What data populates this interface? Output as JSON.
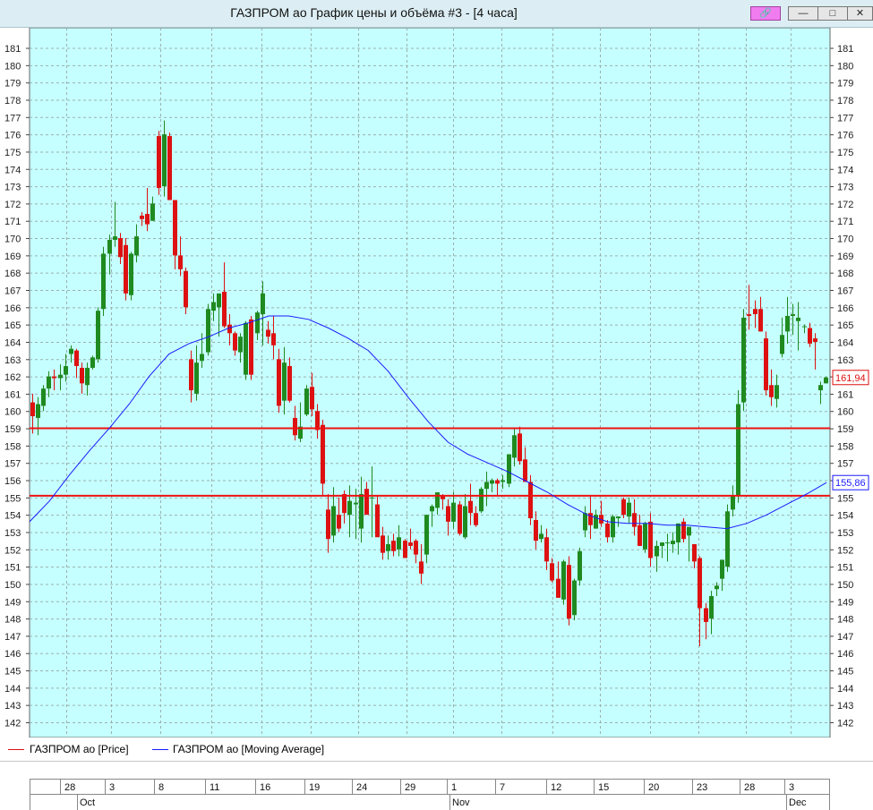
{
  "window": {
    "title": "ГАЗПРОМ ао График цены и объёма #3 - [4 часа]",
    "buttons": [
      "link-icon",
      "minimize-icon",
      "restore-icon",
      "close-icon"
    ]
  },
  "colors": {
    "background": "#c6ffff",
    "grid": "#9ab0b0",
    "up_candle": "#1f8a1f",
    "down_candle": "#dd1111",
    "moving_average": "#1a1aff",
    "level_lines": "#ee1111"
  },
  "legend": {
    "price_label": "ГАЗПРОМ ао [Price]",
    "ma_label": "ГАЗПРОМ ао [Moving Average]"
  },
  "chart_data": {
    "type": "candlestick",
    "y_ticks": [
      142,
      143,
      144,
      145,
      146,
      147,
      148,
      149,
      150,
      151,
      152,
      153,
      154,
      155,
      156,
      157,
      158,
      159,
      160,
      161,
      162,
      163,
      164,
      165,
      166,
      167,
      168,
      169,
      170,
      171,
      172,
      173,
      174,
      175,
      176,
      177,
      178,
      179,
      180,
      181
    ],
    "ylim": [
      141.1,
      182
    ],
    "last_price_label": "161,94",
    "ma_last_label": "155,86",
    "horizontal_levels": [
      159.0,
      155.1
    ],
    "x_day_labels": [
      "28",
      "3",
      "8",
      "11",
      "16",
      "19",
      "24",
      "29",
      "1",
      "7",
      "12",
      "15",
      "20",
      "23",
      "28",
      "3"
    ],
    "x_month_labels": [
      "Oct",
      "Nov",
      "Dec"
    ],
    "candles": [
      [
        160.5,
        161.0,
        158.7,
        159.7
      ],
      [
        159.6,
        160.8,
        158.6,
        160.4
      ],
      [
        160.3,
        161.5,
        160.0,
        161.3
      ],
      [
        161.3,
        162.3,
        160.8,
        162.0
      ],
      [
        162.0,
        162.4,
        161.2,
        161.9
      ],
      [
        161.9,
        162.7,
        161.2,
        162.1
      ],
      [
        162.1,
        163.3,
        161.7,
        162.6
      ],
      [
        163.3,
        163.8,
        162.8,
        163.6
      ],
      [
        163.5,
        163.6,
        161.9,
        162.6
      ],
      [
        162.5,
        162.8,
        161.0,
        161.6
      ],
      [
        161.5,
        162.8,
        160.9,
        162.5
      ],
      [
        162.5,
        163.2,
        162.4,
        163.1
      ],
      [
        163.0,
        166.0,
        162.8,
        165.8
      ],
      [
        165.9,
        169.5,
        165.5,
        169.1
      ],
      [
        169.1,
        170.2,
        167.9,
        169.9
      ],
      [
        169.9,
        172.1,
        169.5,
        170.1
      ],
      [
        170.0,
        170.3,
        168.5,
        168.9
      ],
      [
        169.6,
        170.0,
        166.4,
        166.8
      ],
      [
        166.7,
        169.2,
        166.4,
        169.1
      ],
      [
        169.0,
        170.8,
        168.6,
        170.1
      ],
      [
        171.3,
        171.5,
        170.7,
        171.1
      ],
      [
        171.4,
        172.9,
        170.4,
        170.8
      ],
      [
        171.0,
        172.4,
        171.0,
        172.0
      ],
      [
        175.9,
        176.2,
        172.5,
        172.9
      ],
      [
        173.0,
        176.8,
        172.4,
        176.0
      ],
      [
        175.9,
        176.1,
        172.4,
        172.2
      ],
      [
        172.2,
        172.2,
        168.2,
        169.0
      ],
      [
        169.0,
        170.1,
        167.8,
        168.2
      ],
      [
        168.1,
        168.3,
        165.6,
        166.0
      ],
      [
        163.0,
        163.5,
        160.5,
        161.2
      ],
      [
        161.0,
        163.8,
        160.6,
        162.8
      ],
      [
        162.9,
        164.5,
        162.5,
        163.3
      ],
      [
        163.4,
        166.2,
        163.2,
        165.9
      ],
      [
        165.8,
        166.8,
        165.2,
        166.3
      ],
      [
        166.0,
        166.4,
        164.3,
        166.8
      ],
      [
        166.9,
        168.6,
        164.8,
        164.9
      ],
      [
        165.0,
        165.6,
        163.8,
        164.5
      ],
      [
        164.5,
        164.6,
        163.2,
        163.5
      ],
      [
        163.4,
        164.5,
        162.8,
        164.3
      ],
      [
        162.1,
        165.2,
        161.8,
        165.1
      ],
      [
        165.3,
        165.5,
        161.8,
        162.1
      ],
      [
        164.5,
        165.8,
        164.1,
        165.7
      ],
      [
        165.6,
        167.5,
        163.8,
        166.8
      ],
      [
        164.7,
        165.2,
        163.9,
        164.3
      ],
      [
        164.5,
        165.5,
        163.0,
        163.8
      ],
      [
        163.0,
        163.6,
        159.9,
        160.3
      ],
      [
        160.6,
        163.7,
        159.8,
        162.8
      ],
      [
        162.6,
        163.1,
        160.5,
        160.6
      ],
      [
        159.6,
        160.3,
        158.3,
        158.6
      ],
      [
        158.4,
        160.5,
        158.2,
        159.1
      ],
      [
        159.8,
        161.5,
        159.7,
        161.3
      ],
      [
        161.4,
        162.2,
        159.7,
        160.1
      ],
      [
        160.0,
        160.4,
        158.4,
        158.9
      ],
      [
        159.2,
        159.5,
        155.1,
        155.8
      ],
      [
        154.3,
        155.2,
        151.8,
        152.6
      ],
      [
        152.8,
        155.6,
        152.4,
        154.5
      ],
      [
        154.0,
        155.0,
        153.0,
        153.2
      ],
      [
        155.2,
        155.4,
        153.5,
        154.1
      ],
      [
        154.0,
        155.7,
        152.7,
        154.8
      ],
      [
        154.6,
        155.5,
        152.6,
        154.7
      ],
      [
        153.2,
        156.2,
        152.4,
        155.2
      ],
      [
        155.5,
        155.9,
        154.0,
        154.0
      ],
      [
        155.0,
        156.8,
        152.7,
        155.0
      ],
      [
        154.6,
        155.1,
        152.9,
        152.7
      ],
      [
        152.8,
        153.3,
        151.4,
        151.8
      ],
      [
        151.9,
        152.8,
        151.4,
        152.3
      ],
      [
        152.5,
        152.9,
        151.6,
        151.9
      ],
      [
        152.0,
        153.4,
        151.6,
        152.7
      ],
      [
        152.5,
        152.6,
        151.8,
        151.5
      ],
      [
        152.4,
        153.2,
        152.0,
        152.2
      ],
      [
        152.5,
        152.6,
        151.2,
        151.7
      ],
      [
        151.3,
        152.3,
        150.0,
        150.6
      ],
      [
        151.7,
        154.0,
        151.2,
        154.0
      ],
      [
        154.2,
        154.6,
        153.3,
        154.5
      ],
      [
        154.4,
        155.3,
        154.0,
        155.3
      ],
      [
        155.1,
        155.2,
        154.3,
        154.9
      ],
      [
        154.5,
        154.9,
        152.8,
        153.6
      ],
      [
        153.6,
        155.3,
        153.2,
        154.7
      ],
      [
        154.6,
        154.8,
        152.8,
        152.9
      ],
      [
        152.7,
        155.2,
        152.6,
        154.5
      ],
      [
        154.8,
        155.8,
        153.4,
        154.1
      ],
      [
        154.1,
        154.5,
        153.3,
        153.4
      ],
      [
        154.2,
        155.6,
        154.1,
        155.5
      ],
      [
        155.5,
        156.5,
        154.5,
        155.9
      ],
      [
        155.8,
        156.1,
        155.3,
        156.0
      ],
      [
        156.0,
        156.1,
        155.1,
        155.8
      ],
      [
        155.9,
        156.3,
        155.5,
        156.0
      ],
      [
        155.8,
        157.5,
        155.6,
        157.5
      ],
      [
        157.3,
        159.0,
        156.8,
        158.6
      ],
      [
        158.7,
        159.1,
        156.9,
        157.1
      ],
      [
        157.2,
        157.9,
        156.1,
        155.9
      ],
      [
        155.9,
        156.3,
        153.4,
        153.8
      ],
      [
        153.7,
        154.2,
        152.0,
        152.5
      ],
      [
        152.6,
        153.4,
        152.4,
        152.9
      ],
      [
        152.7,
        153.2,
        150.8,
        151.3
      ],
      [
        151.2,
        151.5,
        150.1,
        150.2
      ],
      [
        150.3,
        151.3,
        149.2,
        149.2
      ],
      [
        149.1,
        151.4,
        148.8,
        151.3
      ],
      [
        151.1,
        151.6,
        147.6,
        148.0
      ],
      [
        148.2,
        150.3,
        147.9,
        150.2
      ],
      [
        150.2,
        152.1,
        149.9,
        151.9
      ],
      [
        153.1,
        154.5,
        152.7,
        154.1
      ],
      [
        154.1,
        155.1,
        152.6,
        153.4
      ],
      [
        153.2,
        154.3,
        153.2,
        154.0
      ],
      [
        154.0,
        154.8,
        153.3,
        153.5
      ],
      [
        153.5,
        153.7,
        152.4,
        152.7
      ],
      [
        152.7,
        154.0,
        152.4,
        153.9
      ],
      [
        153.8,
        153.9,
        153.3,
        153.9
      ],
      [
        154.9,
        155.0,
        153.8,
        154.0
      ],
      [
        153.9,
        155.0,
        153.5,
        154.7
      ],
      [
        154.1,
        154.9,
        152.8,
        153.3
      ],
      [
        153.4,
        154.0,
        152.2,
        152.2
      ],
      [
        152.0,
        153.6,
        151.8,
        153.5
      ],
      [
        153.6,
        154.1,
        151.0,
        151.5
      ],
      [
        151.6,
        152.5,
        150.7,
        152.2
      ],
      [
        152.2,
        152.4,
        151.5,
        152.4
      ],
      [
        152.4,
        152.9,
        151.3,
        152.4
      ],
      [
        152.3,
        153.0,
        151.8,
        152.5
      ],
      [
        152.4,
        153.5,
        151.7,
        153.5
      ],
      [
        153.6,
        153.8,
        152.4,
        152.6
      ],
      [
        152.8,
        153.1,
        151.3,
        153.3
      ],
      [
        152.3,
        152.3,
        150.9,
        151.3
      ],
      [
        151.5,
        151.6,
        146.4,
        148.6
      ],
      [
        148.6,
        148.9,
        146.8,
        147.8
      ],
      [
        148.0,
        149.6,
        147.1,
        149.3
      ],
      [
        149.7,
        150.1,
        149.3,
        149.9
      ],
      [
        150.3,
        150.8,
        149.6,
        151.4
      ],
      [
        151.0,
        154.6,
        150.7,
        154.2
      ],
      [
        154.3,
        155.7,
        153.9,
        155.1
      ],
      [
        155.1,
        161.2,
        154.7,
        160.4
      ],
      [
        160.5,
        165.9,
        160.0,
        165.4
      ],
      [
        165.6,
        167.3,
        164.7,
        165.5
      ],
      [
        165.9,
        166.4,
        164.8,
        165.6
      ],
      [
        165.9,
        166.6,
        164.6,
        164.6
      ],
      [
        164.2,
        164.6,
        160.9,
        161.2
      ],
      [
        161.5,
        162.4,
        160.3,
        160.8
      ],
      [
        160.7,
        162.1,
        160.2,
        161.5
      ],
      [
        163.3,
        165.4,
        163.1,
        164.4
      ],
      [
        164.6,
        166.6,
        163.9,
        165.5
      ],
      [
        165.5,
        166.2,
        164.4,
        165.6
      ],
      [
        165.2,
        166.3,
        163.5,
        165.4
      ],
      [
        164.9,
        165.0,
        164.5,
        164.9
      ],
      [
        164.8,
        165.1,
        163.7,
        163.9
      ],
      [
        164.2,
        164.5,
        162.4,
        164.0
      ],
      [
        161.2,
        161.7,
        160.4,
        161.5
      ],
      [
        161.6,
        162.0,
        161.6,
        161.94
      ]
    ],
    "moving_average": [
      [
        0,
        153.6
      ],
      [
        6,
        154.8
      ],
      [
        12,
        156.3
      ],
      [
        18,
        157.7
      ],
      [
        24,
        159.0
      ],
      [
        30,
        160.4
      ],
      [
        36,
        162.0
      ],
      [
        42,
        163.3
      ],
      [
        48,
        163.9
      ],
      [
        54,
        164.3
      ],
      [
        60,
        164.8
      ],
      [
        66,
        165.1
      ],
      [
        72,
        165.5
      ],
      [
        78,
        165.5
      ],
      [
        84,
        165.3
      ],
      [
        90,
        164.8
      ],
      [
        96,
        164.2
      ],
      [
        102,
        163.5
      ],
      [
        108,
        162.3
      ],
      [
        114,
        160.8
      ],
      [
        120,
        159.4
      ],
      [
        126,
        158.2
      ],
      [
        132,
        157.5
      ],
      [
        138,
        157.0
      ],
      [
        144,
        156.5
      ],
      [
        150,
        155.9
      ],
      [
        156,
        155.3
      ],
      [
        162,
        154.6
      ],
      [
        168,
        154.0
      ],
      [
        174,
        153.6
      ],
      [
        180,
        153.5
      ],
      [
        186,
        153.5
      ],
      [
        192,
        153.4
      ],
      [
        198,
        153.4
      ],
      [
        204,
        153.3
      ],
      [
        210,
        153.2
      ],
      [
        216,
        153.5
      ],
      [
        222,
        154.0
      ],
      [
        228,
        154.6
      ],
      [
        234,
        155.2
      ],
      [
        240,
        155.86
      ]
    ]
  }
}
